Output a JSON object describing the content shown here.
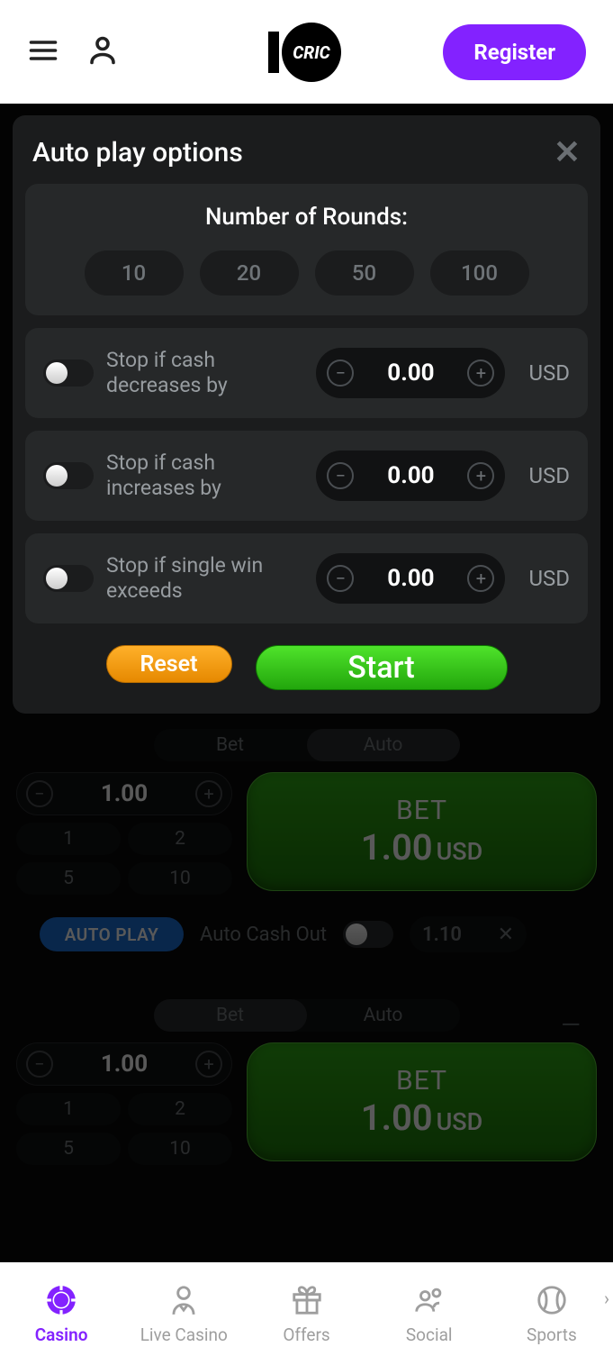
{
  "header": {
    "register_label": "Register",
    "logo_text": "CRIC"
  },
  "modal": {
    "title": "Auto play options",
    "rounds_title": "Number of Rounds:",
    "rounds": [
      "10",
      "20",
      "50",
      "100"
    ],
    "stops": [
      {
        "label": "Stop if cash decreases by",
        "value": "0.00",
        "currency": "USD"
      },
      {
        "label": "Stop if cash increases by",
        "value": "0.00",
        "currency": "USD"
      },
      {
        "label": "Stop if single win exceeds",
        "value": "0.00",
        "currency": "USD"
      }
    ],
    "reset_label": "Reset",
    "start_label": "Start"
  },
  "bet_tabs": {
    "bet": "Bet",
    "auto": "Auto"
  },
  "bet1": {
    "amount": "1.00",
    "presets": [
      "1",
      "2",
      "5",
      "10"
    ],
    "button_title": "BET",
    "button_amount": "1.00",
    "button_ccy": "USD",
    "auto_play": "AUTO PLAY",
    "auto_cash_label": "Auto Cash Out",
    "auto_cash_value": "1.10"
  },
  "bet2": {
    "amount": "1.00",
    "presets": [
      "1",
      "2",
      "5",
      "10"
    ],
    "button_title": "BET",
    "button_amount": "1.00",
    "button_ccy": "USD"
  },
  "nav": {
    "casino": "Casino",
    "live": "Live Casino",
    "offers": "Offers",
    "social": "Social",
    "sports": "Sports"
  }
}
